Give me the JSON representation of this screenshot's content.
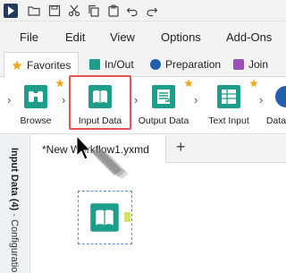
{
  "quick_access": [
    "app-logo",
    "folder-icon",
    "save-icon",
    "scissors-icon",
    "copy-icon",
    "paste-icon",
    "undo-icon",
    "redo-icon"
  ],
  "menu": [
    {
      "label": "File"
    },
    {
      "label": "Edit"
    },
    {
      "label": "View"
    },
    {
      "label": "Options"
    },
    {
      "label": "Add-Ons"
    }
  ],
  "tool_tabs": [
    {
      "label": "Favorites",
      "icon": "star-icon",
      "color": "#f0a81c",
      "active": true
    },
    {
      "label": "In/Out",
      "icon": "folder-tab-icon",
      "color": "#1e9e8a"
    },
    {
      "label": "Preparation",
      "icon": "prep-circle-icon",
      "color": "#1f5fae"
    },
    {
      "label": "Join",
      "icon": "join-square-icon",
      "color": "#9c4fb6"
    }
  ],
  "tools": [
    {
      "label": "Browse",
      "icon": "binoculars-icon",
      "favorite": true
    },
    {
      "label": "Input Data",
      "icon": "book-icon",
      "favorite": false,
      "highlighted": true
    },
    {
      "label": "Output Data",
      "icon": "output-icon",
      "favorite": true
    },
    {
      "label": "Text Input",
      "icon": "text-input-icon",
      "favorite": true
    },
    {
      "label": "Data",
      "icon": "data-icon",
      "favorite": false
    }
  ],
  "side_panel": {
    "title": "Input Data (4)",
    "separator": "-",
    "subtitle": "Configuratio"
  },
  "workflow": {
    "tab_label": "*New Workflow1.yxmd",
    "new_tab": "+"
  },
  "colors": {
    "accent_teal": "#1e9e8a",
    "highlight": "#e05555",
    "star": "#f0a81c",
    "anchor": "#d6e55c"
  }
}
